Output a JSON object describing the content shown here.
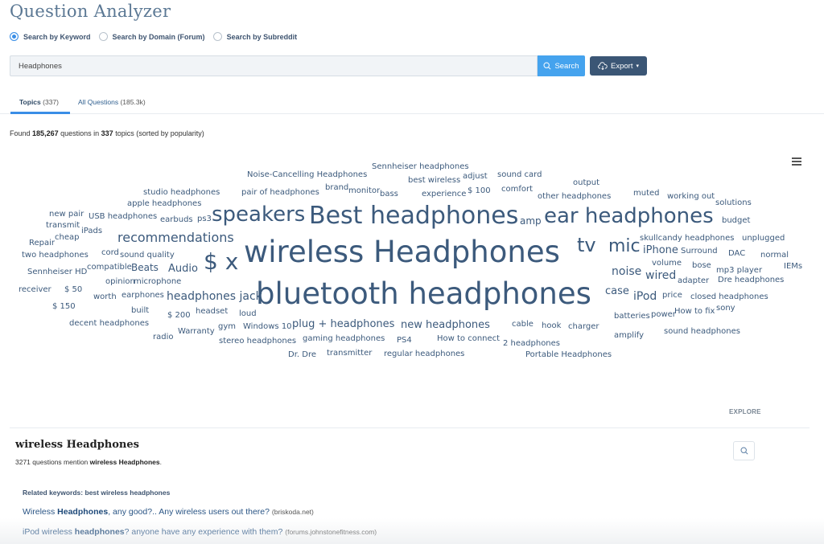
{
  "app": {
    "title": "Question Analyzer"
  },
  "search_modes": [
    {
      "label": "Search by Keyword",
      "selected": true
    },
    {
      "label": "Search by Domain (Forum)",
      "selected": false
    },
    {
      "label": "Search by Subreddit",
      "selected": false
    }
  ],
  "search": {
    "value": "Headphones",
    "button_label": "Search",
    "export_label": "Export"
  },
  "tabs": [
    {
      "label": "Topics",
      "count": "(337)",
      "active": true
    },
    {
      "label": "All Questions",
      "count": "(185.3k)",
      "active": false
    }
  ],
  "summary": {
    "prefix": "Found",
    "questions": "185,267",
    "middle": "questions in",
    "topics": "337",
    "suffix": "topics (sorted by popularity)"
  },
  "word_cloud": {
    "color": "#3c5a7c",
    "words": [
      {
        "text": "wireless Headphones",
        "weight": 100
      },
      {
        "text": "bluetooth headphones",
        "weight": 100
      },
      {
        "text": "Best headphones",
        "weight": 78
      },
      {
        "text": "ear headphones",
        "weight": 70
      },
      {
        "text": "speakers",
        "weight": 68
      },
      {
        "text": "$ x",
        "weight": 80
      },
      {
        "text": "tv",
        "weight": 62
      },
      {
        "text": "mic",
        "weight": 62
      },
      {
        "text": "recommendations",
        "weight": 45
      },
      {
        "text": "noise",
        "weight": 40
      },
      {
        "text": "wired",
        "weight": 38
      },
      {
        "text": "iPod",
        "weight": 38
      },
      {
        "text": "case",
        "weight": 36
      },
      {
        "text": "Audio",
        "weight": 36
      },
      {
        "text": "Beats",
        "weight": 34
      },
      {
        "text": "headphones jack",
        "weight": 36
      },
      {
        "text": "plug + headphones",
        "weight": 34
      },
      {
        "text": "new headphones",
        "weight": 34
      },
      {
        "text": "iPhone",
        "weight": 34
      },
      {
        "text": "amp",
        "weight": 30
      },
      {
        "text": "Noise-Cancelling Headphones",
        "weight": 25
      },
      {
        "text": "Sennheiser headphones",
        "weight": 25
      },
      {
        "text": "best wireless",
        "weight": 25
      },
      {
        "text": "adjust",
        "weight": 25
      },
      {
        "text": "sound card",
        "weight": 25
      },
      {
        "text": "output",
        "weight": 25
      },
      {
        "text": "studio headphones",
        "weight": 25
      },
      {
        "text": "pair of headphones",
        "weight": 25
      },
      {
        "text": "brand",
        "weight": 25
      },
      {
        "text": "monitor",
        "weight": 25
      },
      {
        "text": "bass",
        "weight": 25
      },
      {
        "text": "experience",
        "weight": 25
      },
      {
        "text": "$ 100",
        "weight": 25
      },
      {
        "text": "comfort",
        "weight": 25
      },
      {
        "text": "other headphones",
        "weight": 25
      },
      {
        "text": "muted",
        "weight": 25
      },
      {
        "text": "working out",
        "weight": 25
      },
      {
        "text": "solutions",
        "weight": 25
      },
      {
        "text": "apple headphones",
        "weight": 25
      },
      {
        "text": "new pair",
        "weight": 25
      },
      {
        "text": "USB headphones",
        "weight": 25
      },
      {
        "text": "earbuds",
        "weight": 25
      },
      {
        "text": "ps3",
        "weight": 25
      },
      {
        "text": "budget",
        "weight": 25
      },
      {
        "text": "transmit",
        "weight": 25
      },
      {
        "text": "iPads",
        "weight": 25
      },
      {
        "text": "cheap",
        "weight": 25
      },
      {
        "text": "Repair",
        "weight": 25
      },
      {
        "text": "skullcandy headphones",
        "weight": 25
      },
      {
        "text": "unplugged",
        "weight": 25
      },
      {
        "text": "two headphones",
        "weight": 25
      },
      {
        "text": "cord",
        "weight": 25
      },
      {
        "text": "sound quality",
        "weight": 25
      },
      {
        "text": "Surround",
        "weight": 25
      },
      {
        "text": "DAC",
        "weight": 25
      },
      {
        "text": "normal",
        "weight": 25
      },
      {
        "text": "volume",
        "weight": 25
      },
      {
        "text": "bose",
        "weight": 25
      },
      {
        "text": "mp3 player",
        "weight": 25
      },
      {
        "text": "IEMs",
        "weight": 25
      },
      {
        "text": "Sennheiser HD",
        "weight": 25
      },
      {
        "text": "compatible",
        "weight": 25
      },
      {
        "text": "adapter",
        "weight": 25
      },
      {
        "text": "Dre headphones",
        "weight": 25
      },
      {
        "text": "opinion",
        "weight": 25
      },
      {
        "text": "microphone",
        "weight": 25
      },
      {
        "text": "receiver",
        "weight": 25
      },
      {
        "text": "$ 50",
        "weight": 25
      },
      {
        "text": "price",
        "weight": 25
      },
      {
        "text": "closed headphones",
        "weight": 25
      },
      {
        "text": "worth",
        "weight": 25
      },
      {
        "text": "earphones",
        "weight": 25
      },
      {
        "text": "$ 150",
        "weight": 25
      },
      {
        "text": "built",
        "weight": 25
      },
      {
        "text": "$ 200",
        "weight": 25
      },
      {
        "text": "headset",
        "weight": 25
      },
      {
        "text": "loud",
        "weight": 25
      },
      {
        "text": "batteries",
        "weight": 25
      },
      {
        "text": "power",
        "weight": 25
      },
      {
        "text": "How to fix",
        "weight": 25
      },
      {
        "text": "sony",
        "weight": 25
      },
      {
        "text": "decent headphones",
        "weight": 25
      },
      {
        "text": "gym",
        "weight": 25
      },
      {
        "text": "Windows 10",
        "weight": 25
      },
      {
        "text": "cable",
        "weight": 25
      },
      {
        "text": "hook",
        "weight": 25
      },
      {
        "text": "charger",
        "weight": 25
      },
      {
        "text": "sound headphones",
        "weight": 25
      },
      {
        "text": "radio",
        "weight": 25
      },
      {
        "text": "Warranty",
        "weight": 25
      },
      {
        "text": "amplify",
        "weight": 25
      },
      {
        "text": "stereo headphones",
        "weight": 25
      },
      {
        "text": "gaming headphones",
        "weight": 25
      },
      {
        "text": "PS4",
        "weight": 25
      },
      {
        "text": "How to connect",
        "weight": 25
      },
      {
        "text": "2 headphones",
        "weight": 25
      },
      {
        "text": "Dr. Dre",
        "weight": 25
      },
      {
        "text": "transmitter",
        "weight": 25
      },
      {
        "text": "regular headphones",
        "weight": 25
      },
      {
        "text": "Portable Headphones",
        "weight": 25
      }
    ],
    "explore_label": "EXPLORE"
  },
  "selected_topic": {
    "title": "wireless Headphones",
    "count": "3271",
    "mention_text": "questions mention",
    "mention_term": "wireless Headphones",
    "related_label": "Related keywords:",
    "related_value": "best wireless headphones",
    "questions": [
      {
        "pre": "Wireless ",
        "bold": "Headphones",
        "post": ", any good?.. Any wireless users out there?",
        "source": "(briskoda.net)"
      },
      {
        "pre": "iPod wireless ",
        "bold": "headphones",
        "post": "? anyone have any experience with them?",
        "source": "(forums.johnstonefitness.com)"
      }
    ]
  }
}
